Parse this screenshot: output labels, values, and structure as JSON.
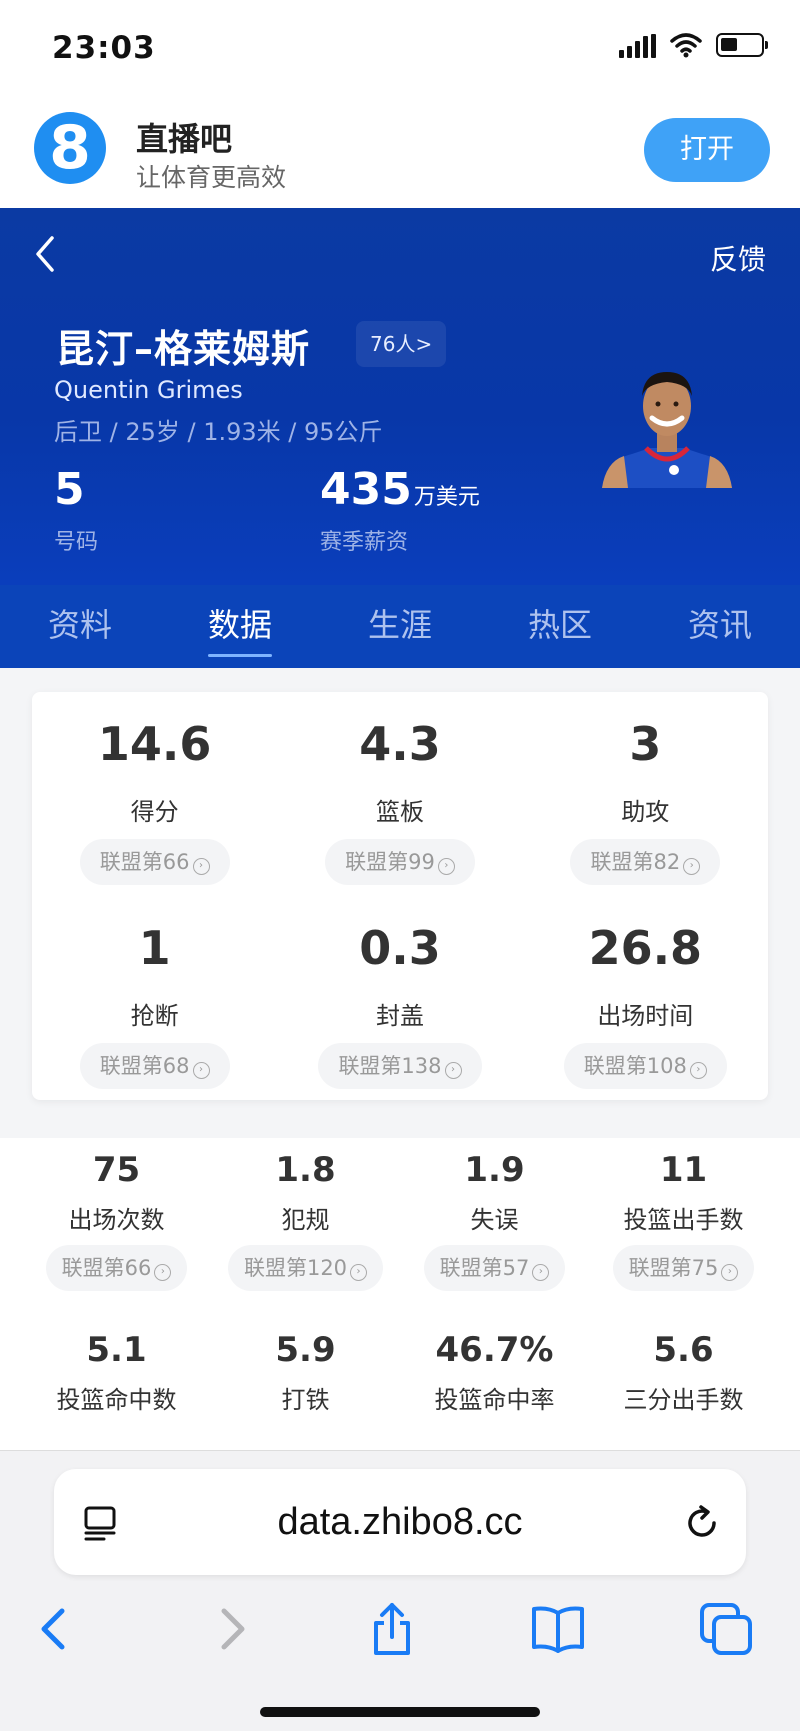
{
  "status": {
    "time": "23:03"
  },
  "banner": {
    "app_name": "直播吧",
    "slogan": "让体育更高效",
    "logo_text": "8",
    "open_label": "打开"
  },
  "header": {
    "feedback_label": "反馈",
    "name_cn": "昆汀–格莱姆斯",
    "team_label": "76人>",
    "name_en": "Quentin Grimes",
    "info": "后卫 / 25岁 / 1.93米 / 95公斤",
    "jersey_number": "5",
    "jersey_label": "号码",
    "salary_value": "435",
    "salary_unit": "万美元",
    "salary_label": "赛季薪资"
  },
  "tabs": [
    "资料",
    "数据",
    "生涯",
    "热区",
    "资讯"
  ],
  "active_tab": "数据",
  "main_stats": [
    {
      "value": "14.6",
      "label": "得分",
      "rank": "联盟第66"
    },
    {
      "value": "4.3",
      "label": "篮板",
      "rank": "联盟第99"
    },
    {
      "value": "3",
      "label": "助攻",
      "rank": "联盟第82"
    },
    {
      "value": "1",
      "label": "抢断",
      "rank": "联盟第68"
    },
    {
      "value": "0.3",
      "label": "封盖",
      "rank": "联盟第138"
    },
    {
      "value": "26.8",
      "label": "出场时间",
      "rank": "联盟第108"
    }
  ],
  "more_stats": [
    {
      "value": "75",
      "label": "出场次数",
      "rank": "联盟第66"
    },
    {
      "value": "1.8",
      "label": "犯规",
      "rank": "联盟第120"
    },
    {
      "value": "1.9",
      "label": "失误",
      "rank": "联盟第57"
    },
    {
      "value": "11",
      "label": "投篮出手数",
      "rank": "联盟第75"
    },
    {
      "value": "5.1",
      "label": "投篮命中数"
    },
    {
      "value": "5.9",
      "label": "打铁"
    },
    {
      "value": "46.7%",
      "label": "投篮命中率"
    },
    {
      "value": "5.6",
      "label": "三分出手数"
    }
  ],
  "browser": {
    "url": "data.zhibo8.cc"
  },
  "colors": {
    "header_blue": "#0b3aa3",
    "tab_blue": "#0b44b9",
    "brand_blue": "#1f8ef1",
    "ios_blue": "#1a7cf5"
  },
  "icons": [
    "signal-icon",
    "wifi-icon",
    "battery-icon",
    "back-icon",
    "reader-mode-icon",
    "reload-icon",
    "nav-back-icon",
    "nav-forward-icon",
    "share-icon",
    "bookmarks-icon",
    "tabs-icon"
  ]
}
